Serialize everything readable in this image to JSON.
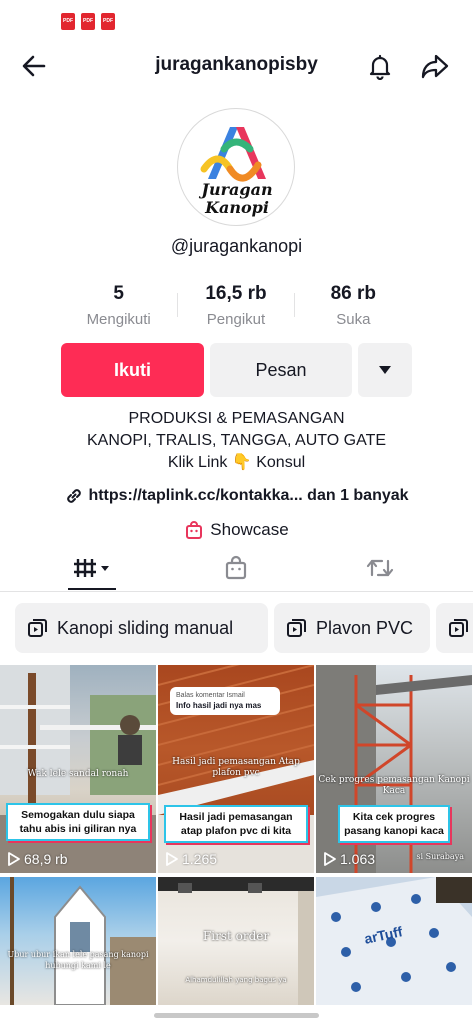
{
  "status_bar": {
    "notification_icons": [
      "pdf-icon",
      "pdf-icon",
      "pdf-icon"
    ],
    "pdf_label": "PDF"
  },
  "header": {
    "username": "juragankanopisby",
    "back_icon": "arrow-left-icon",
    "bell_icon": "bell-icon",
    "share_icon": "share-icon"
  },
  "profile": {
    "avatar_logo_line1": "Juragan",
    "avatar_logo_line2": "Kanopi",
    "handle": "@juragankanopi",
    "stats": [
      {
        "value": "5",
        "label": "Mengikuti"
      },
      {
        "value": "16,5 rb",
        "label": "Pengikut"
      },
      {
        "value": "86 rb",
        "label": "Suka"
      }
    ],
    "follow_label": "Ikuti",
    "message_label": "Pesan",
    "more_icon": "caret-down-icon",
    "bio_line1": "PRODUKSI & PEMASANGAN",
    "bio_line2": "KANOPI, TRALIS, TANGGA, AUTO GATE",
    "bio_line3_text": "Klik Link",
    "bio_line3_emoji": "👇",
    "bio_line3_end": "Konsul",
    "link_text": "https://taplink.cc/kontakka... dan 1 banyak",
    "showcase_label": "Showcase"
  },
  "tabs": [
    {
      "name": "videos-grid-tab",
      "icon": "grid-bars-icon",
      "active": true
    },
    {
      "name": "shop-tab",
      "icon": "shopping-bag-icon",
      "active": false
    },
    {
      "name": "reposts-tab",
      "icon": "repost-icon",
      "active": false
    }
  ],
  "playlists": [
    {
      "label": "Kanopi sliding manual"
    },
    {
      "label": "Plavon PVC"
    },
    {
      "label": ""
    }
  ],
  "videos": [
    {
      "overlay_text": "Wak lele sandal ronah",
      "caption": "Semogakan dulu siapa tahu abis ini giliran nya",
      "views": "68,9 rb"
    },
    {
      "comment_header": "Balas komentar Ismail",
      "comment_text": "Info hasil jadi nya mas",
      "overlay_text": "Hasil jadi pemasangan Atap plafon pvc",
      "caption": "Hasil jadi pemasangan atap plafon pvc di kita",
      "views": "1.265"
    },
    {
      "overlay_text": "Cek progres pemasangan Kanopi Kaca",
      "caption": "Kita cek progres pasang kanopi kaca",
      "footer_text": "si Surabaya",
      "views": "1.063"
    },
    {
      "overlay_text": "Ubur ubur ikan lele pasang kanopi hubungi kami le",
      "caption": "",
      "views": ""
    },
    {
      "overlay_text": "First order",
      "sub_text": "Alhamdulillah yang bagus ya",
      "caption": "",
      "views": ""
    },
    {
      "overlay_text": "arTuff",
      "caption": "",
      "views": ""
    }
  ],
  "colors": {
    "accent": "#fe2c55",
    "text": "#161823",
    "muted": "#8a8b91",
    "chip_bg": "#f1f1f2",
    "caption_border": "#2dc4e8",
    "caption_shadow": "#e8365c"
  }
}
